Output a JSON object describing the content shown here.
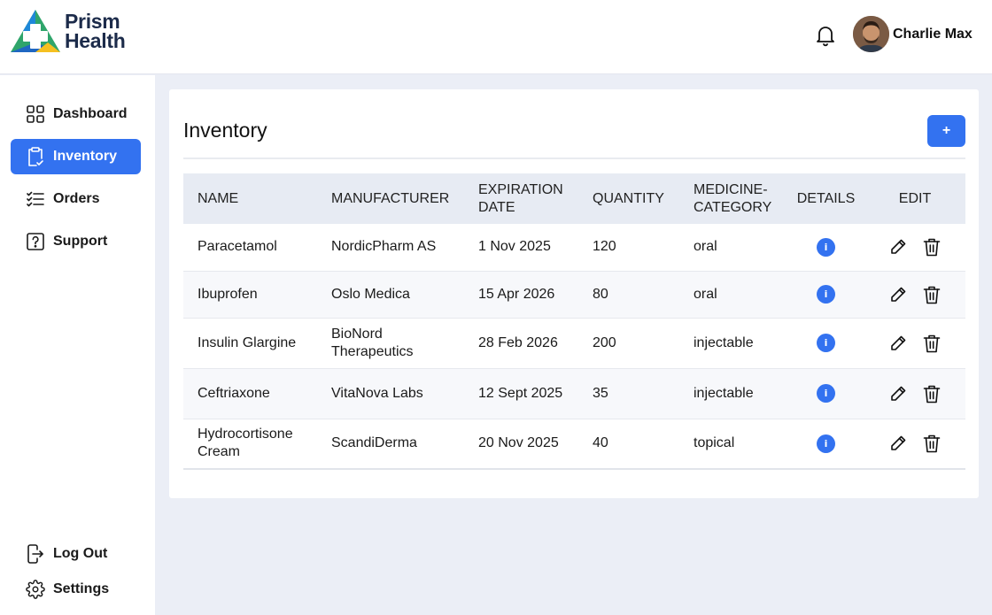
{
  "brand": {
    "line1": "Prism",
    "line2": "Health"
  },
  "user": {
    "name": "Charlie Max"
  },
  "nav": {
    "items": [
      {
        "label": "Dashboard",
        "icon": "grid-icon"
      },
      {
        "label": "Inventory",
        "icon": "clipboard-check-icon",
        "active": true
      },
      {
        "label": "Orders",
        "icon": "list-check-icon"
      },
      {
        "label": "Support",
        "icon": "question-icon"
      }
    ],
    "bottom": [
      {
        "label": "Log Out",
        "icon": "logout-icon"
      },
      {
        "label": "Settings",
        "icon": "gear-icon"
      }
    ]
  },
  "inventory": {
    "title": "Inventory",
    "add_label": "+",
    "columns": [
      "NAME",
      "MANUFACTURER",
      "EXPIRATION DATE",
      "QUANTITY",
      "MEDICINE-CATEGORY",
      "DETAILS",
      "EDIT"
    ],
    "rows": [
      {
        "name": "Paracetamol",
        "manufacturer": "NordicPharm AS",
        "expiration": "1 Nov 2025",
        "quantity": "120",
        "category": "oral"
      },
      {
        "name": "Ibuprofen",
        "manufacturer": "Oslo Medica",
        "expiration": "15 Apr 2026",
        "quantity": "80",
        "category": "oral"
      },
      {
        "name": "Insulin Glargine",
        "manufacturer": "BioNord Therapeutics",
        "expiration": "28 Feb 2026",
        "quantity": "200",
        "category": "injectable"
      },
      {
        "name": "Ceftriaxone",
        "manufacturer": "VitaNova Labs",
        "expiration": "12 Sept 2025",
        "quantity": "35",
        "category": "injectable"
      },
      {
        "name": "Hydrocortisone Cream",
        "manufacturer": "ScandiDerma",
        "expiration": "20 Nov 2025",
        "quantity": "40",
        "category": "topical"
      }
    ],
    "details_glyph": "i"
  },
  "colors": {
    "accent": "#3372f0",
    "header_bg": "#e7ebf3",
    "page_bg": "#ebeef6"
  }
}
